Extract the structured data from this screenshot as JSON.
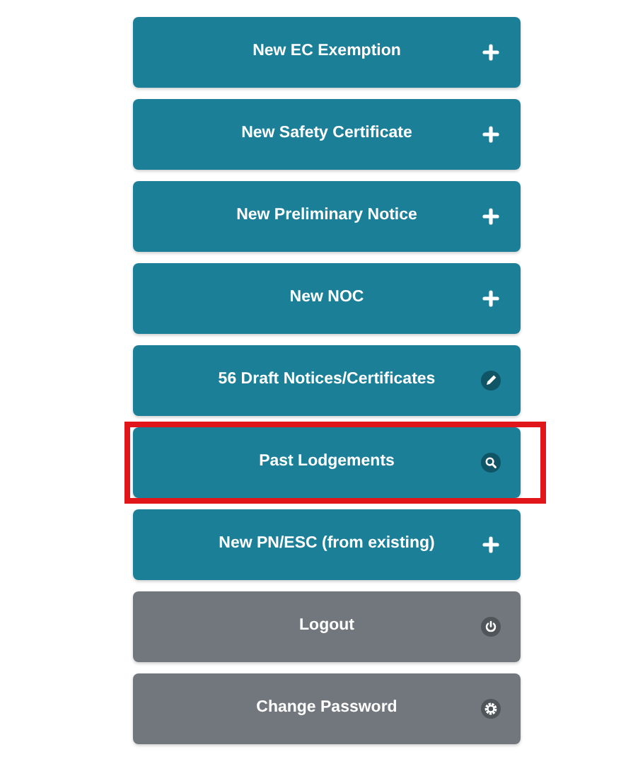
{
  "menu_buttons": [
    {
      "label": "New EC Exemption",
      "kind": "primary",
      "highlighted": false
    },
    {
      "label": "New Safety Certificate",
      "kind": "primary",
      "highlighted": false
    },
    {
      "label": "New Preliminary Notice",
      "kind": "primary",
      "highlighted": false
    },
    {
      "label": "New NOC",
      "kind": "primary",
      "highlighted": false
    },
    {
      "label": "56 Draft Notices/Certificates",
      "kind": "primary",
      "highlighted": false
    },
    {
      "label": "Past Lodgements",
      "kind": "primary",
      "highlighted": true
    },
    {
      "label": "New PN/ESC (from existing)",
      "kind": "primary",
      "highlighted": false
    },
    {
      "label": "Logout",
      "kind": "secondary",
      "highlighted": false
    },
    {
      "label": "Change Password",
      "kind": "secondary",
      "highlighted": false
    }
  ]
}
